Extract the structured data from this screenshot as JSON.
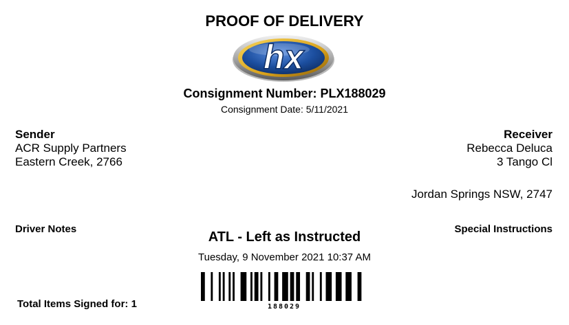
{
  "document": {
    "title": "PROOF OF DELIVERY",
    "logo_text": "hx",
    "consignment_number": "Consignment Number: PLX188029",
    "consignment_date": "Consignment Date: 5/11/2021"
  },
  "sender": {
    "heading": "Sender",
    "name": "ACR Supply Partners",
    "location": "Eastern Creek, 2766"
  },
  "receiver": {
    "heading": "Receiver",
    "name": "Rebecca Deluca",
    "street": "3 Tango Cl",
    "location": "Jordan Springs NSW, 2747"
  },
  "labels": {
    "driver_notes": "Driver Notes",
    "special_instructions": "Special Instructions",
    "total_items": "Total Items Signed for: 1"
  },
  "delivery": {
    "status": "ATL - Left as Instructed",
    "timestamp": "Tuesday, 9 November 2021 10:37 AM",
    "barcode_text": "188029"
  },
  "colors": {
    "logo_blue": "#1c4fa0",
    "logo_gold": "#d9a21b",
    "logo_silver": "#b9b9b9"
  }
}
